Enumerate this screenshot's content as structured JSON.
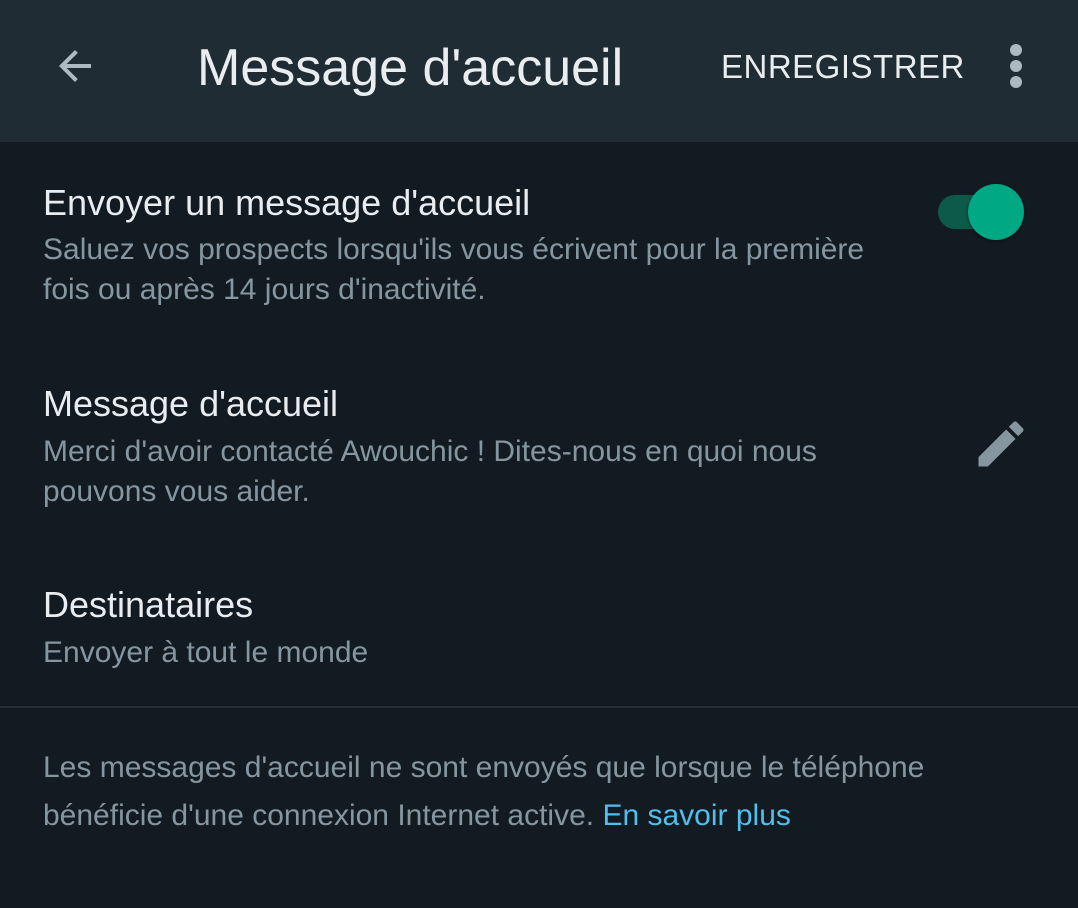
{
  "appbar": {
    "back_icon": "arrow-left-icon",
    "title": "Message d'accueil",
    "save_label": "ENREGISTRER",
    "more_icon": "more-vertical-icon"
  },
  "settings": {
    "send_greeting": {
      "title": "Envoyer un message d'accueil",
      "subtitle": "Saluez vos prospects lorsqu'ils vous écrivent pour la première fois ou après 14 jours d'inactivité.",
      "enabled": true
    },
    "greeting_message": {
      "title": "Message d'accueil",
      "subtitle": "Merci d'avoir contacté Awouchic ! Dites-nous en quoi nous pouvons vous aider.",
      "edit_icon": "pencil-icon"
    },
    "recipients": {
      "title": "Destinataires",
      "subtitle": "Envoyer à tout le monde"
    }
  },
  "footer": {
    "note": "Les messages d'accueil ne sont envoyés que lorsque le téléphone bénéficie d'une connexion Internet active.",
    "learn_more_label": "En savoir plus"
  },
  "colors": {
    "background": "#121b22",
    "appbar": "#1f2c34",
    "accent": "#00a884",
    "link": "#53bdeb",
    "primary_text": "#e9edef",
    "secondary_text": "#8696a0"
  }
}
